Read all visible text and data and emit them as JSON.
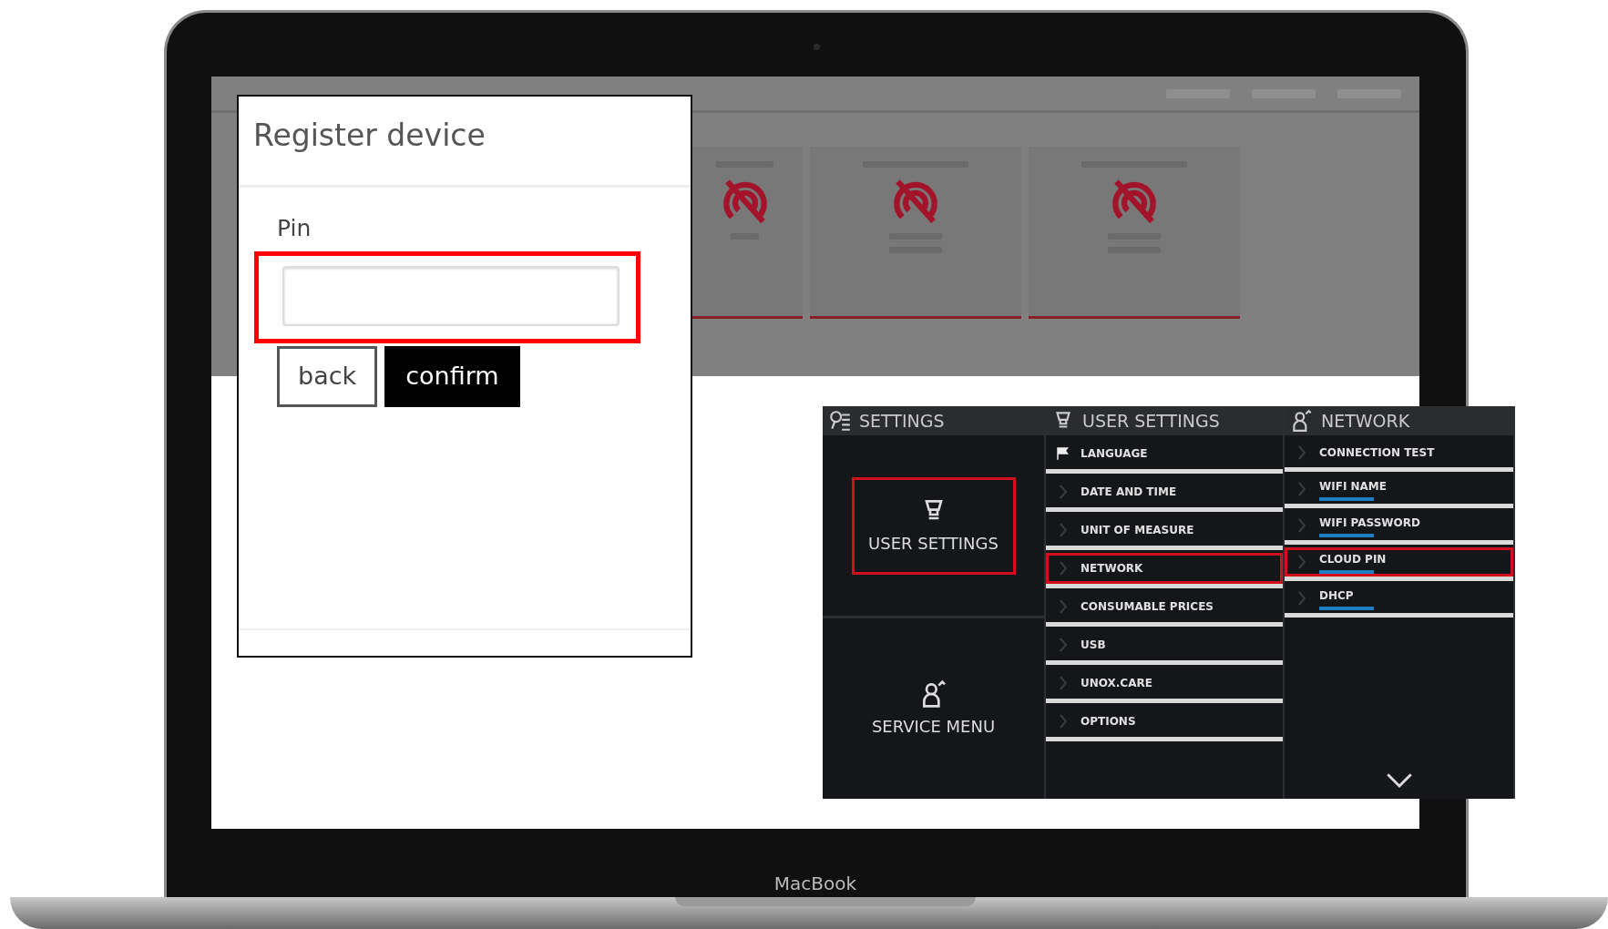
{
  "laptop": {
    "brand": "MacBook"
  },
  "dialog": {
    "title": "Register device",
    "field": {
      "label": "Pin",
      "highlighted": true
    },
    "buttons": [
      {
        "label": "back",
        "kind": "secondary"
      },
      {
        "label": "confirm",
        "kind": "primary"
      }
    ]
  },
  "settings_panel": {
    "columns": [
      {
        "title": "SETTINGS",
        "kind": "tiles",
        "items": [
          {
            "label": "USER SETTINGS",
            "kind": "user",
            "selected": true
          },
          {
            "label": "SERVICE MENU",
            "kind": "service",
            "selected": false
          }
        ]
      },
      {
        "title": "USER SETTINGS",
        "kind": "list",
        "items": [
          {
            "label": "LANGUAGE",
            "kind": "flag",
            "selected": false
          },
          {
            "label": "DATE AND TIME",
            "kind": "arrow",
            "selected": false
          },
          {
            "label": "UNIT OF MEASURE",
            "kind": "arrow",
            "selected": false
          },
          {
            "label": "NETWORK",
            "kind": "arrow",
            "selected": true
          },
          {
            "label": "CONSUMABLE PRICES",
            "kind": "arrow",
            "selected": false
          },
          {
            "label": "USB",
            "kind": "arrow",
            "selected": false
          },
          {
            "label": "UNOX.CARE",
            "kind": "arrow",
            "selected": false
          },
          {
            "label": "OPTIONS",
            "kind": "arrow",
            "selected": false
          }
        ]
      },
      {
        "title": "NETWORK",
        "kind": "list",
        "items": [
          {
            "label": "CONNECTION TEST",
            "kind": "arrow",
            "selected": false
          },
          {
            "label": "WIFI NAME",
            "kind": "value",
            "selected": false
          },
          {
            "label": "WIFI PASSWORD",
            "kind": "value",
            "selected": false
          },
          {
            "label": "CLOUD PIN",
            "kind": "value",
            "selected": true
          },
          {
            "label": "DHCP",
            "kind": "value",
            "selected": false
          }
        ]
      }
    ]
  }
}
